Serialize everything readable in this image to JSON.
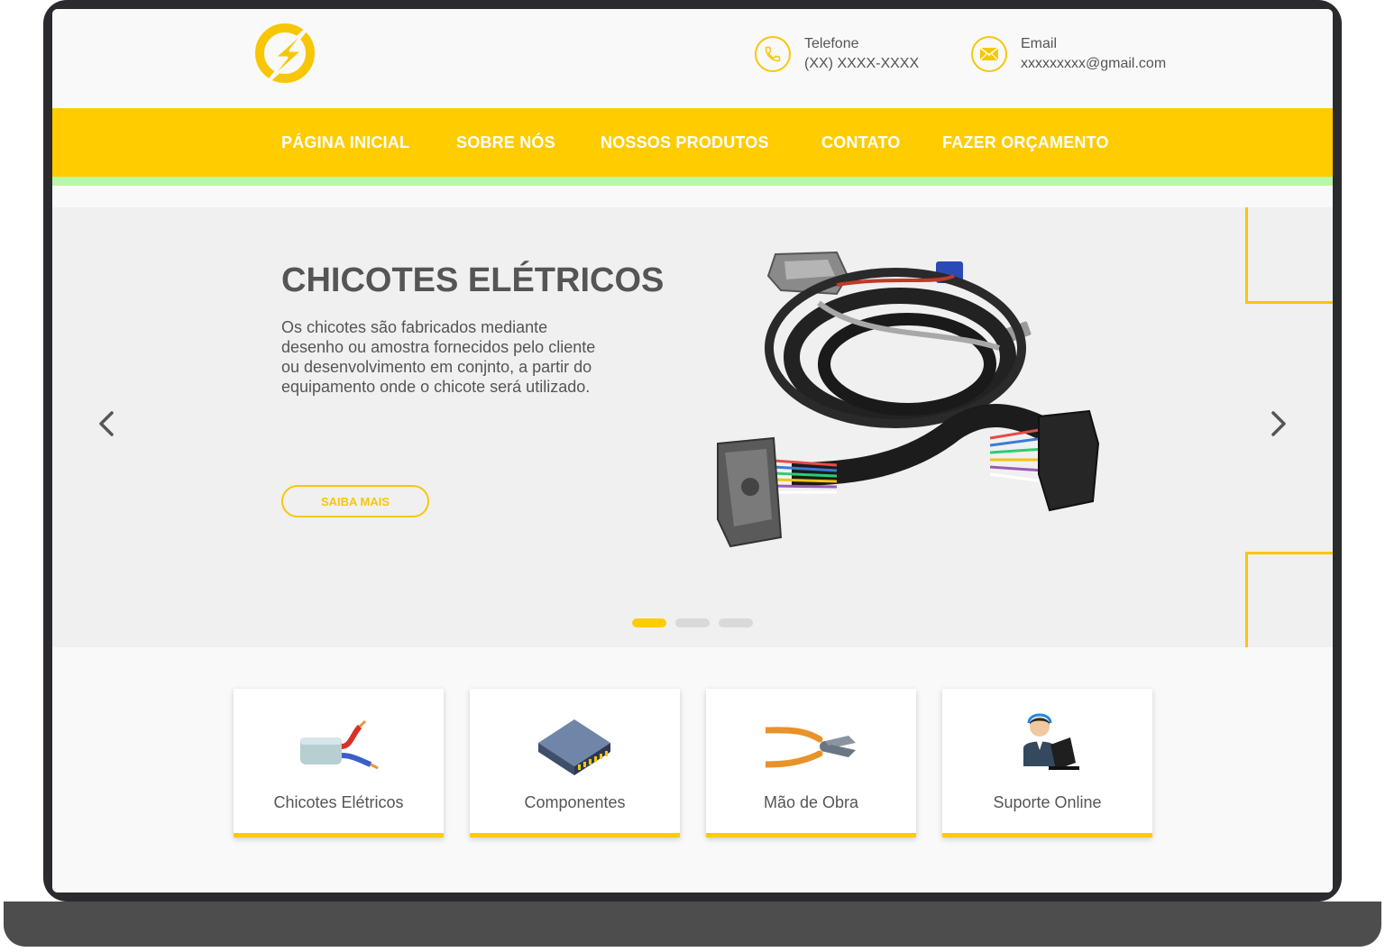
{
  "header": {
    "phone": {
      "label": "Telefone",
      "value": "(XX) XXXX-XXXX"
    },
    "email": {
      "label": "Email",
      "value": "xxxxxxxxx@gmail.com"
    }
  },
  "nav": {
    "items": [
      "PÁGINA INICIAL",
      "SOBRE NÓS",
      "NOSSOS PRODUTOS",
      "CONTATO",
      "FAZER ORÇAMENTO"
    ]
  },
  "hero": {
    "title": "CHICOTES ELÉTRICOS",
    "description": "Os chicotes são fabricados mediante desenho ou amostra fornecidos pelo cliente ou desenvolvimento em conjnto, a partir do equipamento onde o chicote será utilizado.",
    "button_label": "SAIBA MAIS",
    "slides_count": 3,
    "active_slide": 1
  },
  "cards": [
    {
      "label": "Chicotes Elétricos",
      "icon": "cable-icon"
    },
    {
      "label": "Componentes",
      "icon": "chip-icon"
    },
    {
      "label": "Mão de Obra",
      "icon": "pliers-icon"
    },
    {
      "label": "Suporte Online",
      "icon": "support-agent-icon"
    }
  ],
  "colors": {
    "accent": "#ffcc00",
    "green_strip": "#b9f7a6",
    "text": "#555555",
    "hero_bg": "#f0f0f0"
  }
}
